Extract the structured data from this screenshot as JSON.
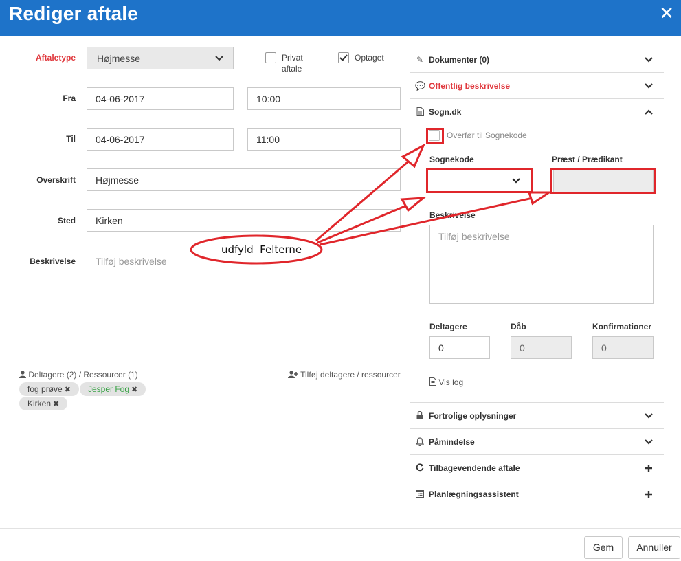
{
  "header": {
    "title": "Rediger aftale",
    "close_glyph": "✕"
  },
  "form": {
    "aftaletype": {
      "label": "Aftaletype",
      "value": "Højmesse"
    },
    "privat": {
      "label_line1": "Privat",
      "label_line2": "aftale",
      "checked": false
    },
    "optaget": {
      "label": "Optaget",
      "checked": true
    },
    "fra": {
      "label": "Fra",
      "date": "04-06-2017",
      "time": "10:00"
    },
    "til": {
      "label": "Til",
      "date": "04-06-2017",
      "time": "11:00"
    },
    "overskrift": {
      "label": "Overskrift",
      "value": "Højmesse"
    },
    "sted": {
      "label": "Sted",
      "value": "Kirken"
    },
    "beskrivelse": {
      "label": "Beskrivelse",
      "placeholder": "Tilføj beskrivelse"
    }
  },
  "participants": {
    "summary": "Deltagere (2) / Ressourcer (1)",
    "add_label": "Tilføj deltagere / ressourcer",
    "tags": [
      {
        "label": "fog prøve",
        "color": "#444444"
      },
      {
        "label": "Jesper Fog",
        "color": "#3aa347"
      },
      {
        "label": "Kirken",
        "color": "#444444"
      }
    ]
  },
  "accordion": {
    "dokumenter": {
      "label": "Dokumenter (0)",
      "icon": "paperclip-icon"
    },
    "offentlig": {
      "label": "Offentlig beskrivelse",
      "icon": "comment-icon",
      "color": "#e0393e"
    },
    "sogn": {
      "label": "Sogn.dk",
      "icon": "document-icon"
    },
    "fortrolige": {
      "label": "Fortrolige oplysninger",
      "icon": "lock-icon"
    },
    "paamindelse": {
      "label": "Påmindelse",
      "icon": "bell-icon"
    },
    "tilbagevendende": {
      "label": "Tilbagevendende aftale",
      "icon": "refresh-icon"
    },
    "planlaegning": {
      "label": "Planlægningsassistent",
      "icon": "calendar-icon"
    }
  },
  "sogn": {
    "overfor_label": "Overfør til Sognekode",
    "sognekode_label": "Sognekode",
    "praest_label": "Præst / Prædikant",
    "beskrivelse_label": "Beskrivelse",
    "beskrivelse_placeholder": "Tilføj beskrivelse",
    "deltagere_label": "Deltagere",
    "deltagere_value": "0",
    "daab_label": "Dåb",
    "daab_value": "0",
    "konfirmationer_label": "Konfirmationer",
    "konfirmationer_value": "0",
    "vis_log": "Vis log"
  },
  "annotation": {
    "text_1": "udfyld",
    "text_2": "Felterne",
    "color": "#e0262b"
  },
  "footer": {
    "save": "Gem",
    "cancel": "Annuller"
  }
}
